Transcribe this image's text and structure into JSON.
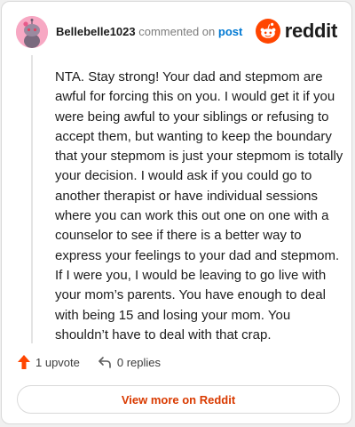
{
  "comment": {
    "username": "Bellebelle1023",
    "action_text": "commented on",
    "post_link": "post",
    "body": "NTA. Stay strong! Your dad and stepmom are awful for forcing this on you. I would get it if you were being awful to your siblings or refusing to accept them, but wanting to keep the boundary that your stepmom is just your stepmom is totally your decision. I would ask if you could go to another therapist or have individual sessions where you can work this out one on one with a counselor to see if there is a better way to express your feelings to your dad and stepmom. If I were you, I would be leaving to go live with your mom’s parents. You have enough to deal with being 15 and losing your mom. You shouldn’t have to deal with that crap."
  },
  "brand": {
    "name": "reddit",
    "icon": "reddit-logo-icon",
    "color": "#ff4500"
  },
  "actions": {
    "upvote_label": "1 upvote",
    "upvote_icon": "upvote-arrow-icon",
    "upvote_color": "#ff4500",
    "replies_label": "0 replies",
    "replies_icon": "reply-arrow-icon"
  },
  "footer": {
    "view_more_label": "View more on Reddit",
    "accent": "#d93a00"
  }
}
